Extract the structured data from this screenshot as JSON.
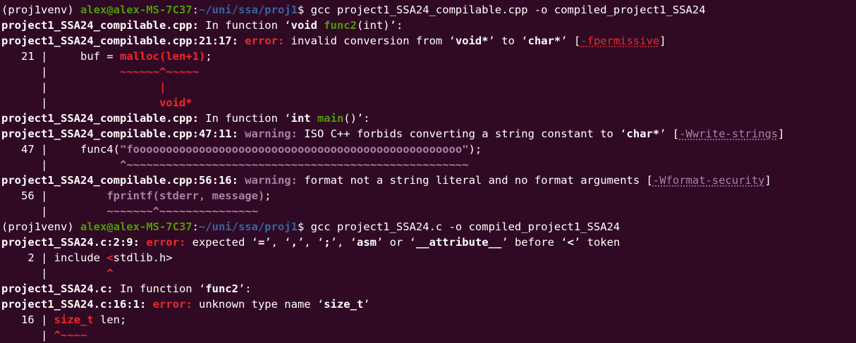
{
  "colors": {
    "background": "#300a24",
    "text": "#ffffff",
    "prompt_user": "#4e9a06",
    "prompt_path": "#3465a4",
    "error": "#ef2929",
    "warning": "#ad7fa8"
  },
  "terminal": {
    "lines": [
      [
        {
          "t": "(proj1venv) ",
          "c": "text"
        },
        {
          "t": "alex@alex-MS-7C37",
          "c": "prompt_user",
          "b": true
        },
        {
          "t": ":",
          "c": "text"
        },
        {
          "t": "~/uni/ssa/proj1",
          "c": "prompt_path",
          "b": true
        },
        {
          "t": "$ gcc project1_SSA24_compilable.cpp -o compiled_project1_SSA24",
          "c": "text"
        }
      ],
      [
        {
          "t": "project1_SSA24_compilable.cpp:",
          "c": "text",
          "b": true
        },
        {
          "t": " In function ‘",
          "c": "text"
        },
        {
          "t": "void ",
          "c": "text",
          "b": true
        },
        {
          "t": "func2",
          "c": "prompt_user",
          "b": true
        },
        {
          "t": "(int)’:",
          "c": "text"
        }
      ],
      [
        {
          "t": "project1_SSA24_compilable.cpp:21:17:",
          "c": "text",
          "b": true
        },
        {
          "t": " ",
          "c": "text"
        },
        {
          "t": "error:",
          "c": "error",
          "b": true
        },
        {
          "t": " invalid conversion from ‘",
          "c": "text"
        },
        {
          "t": "void*",
          "c": "text",
          "b": true
        },
        {
          "t": "’ to ‘",
          "c": "text"
        },
        {
          "t": "char*",
          "c": "text",
          "b": true
        },
        {
          "t": "’ [",
          "c": "text"
        },
        {
          "t": "-fpermissive",
          "c": "error",
          "u": true
        },
        {
          "t": "]",
          "c": "text"
        }
      ],
      [
        {
          "t": "   21 | ",
          "c": "text"
        },
        {
          "t": "    buf = ",
          "c": "text"
        },
        {
          "t": "malloc(len+1)",
          "c": "error",
          "b": true
        },
        {
          "t": ";",
          "c": "text"
        }
      ],
      [
        {
          "t": "      | ",
          "c": "text"
        },
        {
          "t": "          ",
          "c": "text"
        },
        {
          "t": "~~~~~~^~~~~~",
          "c": "error",
          "b": true
        }
      ],
      [
        {
          "t": "      | ",
          "c": "text"
        },
        {
          "t": "                ",
          "c": "text"
        },
        {
          "t": "|",
          "c": "error",
          "b": true
        }
      ],
      [
        {
          "t": "      | ",
          "c": "text"
        },
        {
          "t": "                ",
          "c": "text"
        },
        {
          "t": "void*",
          "c": "error",
          "b": true
        }
      ],
      [
        {
          "t": "project1_SSA24_compilable.cpp:",
          "c": "text",
          "b": true
        },
        {
          "t": " In function ‘",
          "c": "text"
        },
        {
          "t": "int ",
          "c": "text",
          "b": true
        },
        {
          "t": "main",
          "c": "prompt_user",
          "b": true
        },
        {
          "t": "()’:",
          "c": "text"
        }
      ],
      [
        {
          "t": "project1_SSA24_compilable.cpp:47:11:",
          "c": "text",
          "b": true
        },
        {
          "t": " ",
          "c": "text"
        },
        {
          "t": "warning:",
          "c": "warning",
          "b": true
        },
        {
          "t": " ISO C++ forbids converting a string constant to ‘",
          "c": "text"
        },
        {
          "t": "char*",
          "c": "text",
          "b": true
        },
        {
          "t": "’ [",
          "c": "text"
        },
        {
          "t": "-Wwrite-strings",
          "c": "warning",
          "u": true
        },
        {
          "t": "]",
          "c": "text"
        }
      ],
      [
        {
          "t": "   47 | ",
          "c": "text"
        },
        {
          "t": "    func4(",
          "c": "text"
        },
        {
          "t": "\"foooooooooooooooooooooooooooooooooooooooooooooooooo\"",
          "c": "warning",
          "b": true
        },
        {
          "t": ");",
          "c": "text"
        }
      ],
      [
        {
          "t": "      | ",
          "c": "text"
        },
        {
          "t": "          ",
          "c": "text"
        },
        {
          "t": "^~~~~~~~~~~~~~~~~~~~~~~~~~~~~~~~~~~~~~~~~~~~~~~~~~~~~",
          "c": "warning",
          "b": true
        }
      ],
      [
        {
          "t": "project1_SSA24_compilable.cpp:56:16:",
          "c": "text",
          "b": true
        },
        {
          "t": " ",
          "c": "text"
        },
        {
          "t": "warning:",
          "c": "warning",
          "b": true
        },
        {
          "t": " format not a string literal and no format arguments [",
          "c": "text"
        },
        {
          "t": "-Wformat-security",
          "c": "warning",
          "u": true
        },
        {
          "t": "]",
          "c": "text"
        }
      ],
      [
        {
          "t": "   56 | ",
          "c": "text"
        },
        {
          "t": "        ",
          "c": "text"
        },
        {
          "t": "fprintf(stderr, message)",
          "c": "warning",
          "b": true
        },
        {
          "t": ";",
          "c": "text"
        }
      ],
      [
        {
          "t": "      | ",
          "c": "text"
        },
        {
          "t": "        ",
          "c": "text"
        },
        {
          "t": "~~~~~~~^~~~~~~~~~~~~~~~",
          "c": "warning",
          "b": true
        }
      ],
      [
        {
          "t": "(proj1venv) ",
          "c": "text"
        },
        {
          "t": "alex@alex-MS-7C37",
          "c": "prompt_user",
          "b": true
        },
        {
          "t": ":",
          "c": "text"
        },
        {
          "t": "~/uni/ssa/proj1",
          "c": "prompt_path",
          "b": true
        },
        {
          "t": "$ gcc project1_SSA24.c -o compiled_project1_SSA24",
          "c": "text"
        }
      ],
      [
        {
          "t": "project1_SSA24.c:2:9:",
          "c": "text",
          "b": true
        },
        {
          "t": " ",
          "c": "text"
        },
        {
          "t": "error:",
          "c": "error",
          "b": true
        },
        {
          "t": " expected ‘",
          "c": "text"
        },
        {
          "t": "=",
          "c": "text",
          "b": true
        },
        {
          "t": "’, ‘",
          "c": "text"
        },
        {
          "t": ",",
          "c": "text",
          "b": true
        },
        {
          "t": "’, ‘",
          "c": "text"
        },
        {
          "t": ";",
          "c": "text",
          "b": true
        },
        {
          "t": "’, ‘",
          "c": "text"
        },
        {
          "t": "asm",
          "c": "text",
          "b": true
        },
        {
          "t": "’ or ‘",
          "c": "text"
        },
        {
          "t": "__attribute__",
          "c": "text",
          "b": true
        },
        {
          "t": "’ before ‘",
          "c": "text"
        },
        {
          "t": "<",
          "c": "text",
          "b": true
        },
        {
          "t": "’ token",
          "c": "text"
        }
      ],
      [
        {
          "t": "    2 | ",
          "c": "text"
        },
        {
          "t": "include ",
          "c": "text"
        },
        {
          "t": "<",
          "c": "error",
          "b": true
        },
        {
          "t": "stdlib.h>",
          "c": "text"
        }
      ],
      [
        {
          "t": "      | ",
          "c": "text"
        },
        {
          "t": "        ",
          "c": "text"
        },
        {
          "t": "^",
          "c": "error",
          "b": true
        }
      ],
      [
        {
          "t": "project1_SSA24.c:",
          "c": "text",
          "b": true
        },
        {
          "t": " In function ‘",
          "c": "text"
        },
        {
          "t": "func2",
          "c": "text",
          "b": true
        },
        {
          "t": "’:",
          "c": "text"
        }
      ],
      [
        {
          "t": "project1_SSA24.c:16:1:",
          "c": "text",
          "b": true
        },
        {
          "t": " ",
          "c": "text"
        },
        {
          "t": "error:",
          "c": "error",
          "b": true
        },
        {
          "t": " unknown type name ‘",
          "c": "text"
        },
        {
          "t": "size_t",
          "c": "text",
          "b": true
        },
        {
          "t": "’",
          "c": "text"
        }
      ],
      [
        {
          "t": "   16 | ",
          "c": "text"
        },
        {
          "t": "size_t",
          "c": "error",
          "b": true
        },
        {
          "t": " len;",
          "c": "text"
        }
      ],
      [
        {
          "t": "      | ",
          "c": "text"
        },
        {
          "t": "^~~~~",
          "c": "error",
          "b": true
        }
      ]
    ]
  }
}
